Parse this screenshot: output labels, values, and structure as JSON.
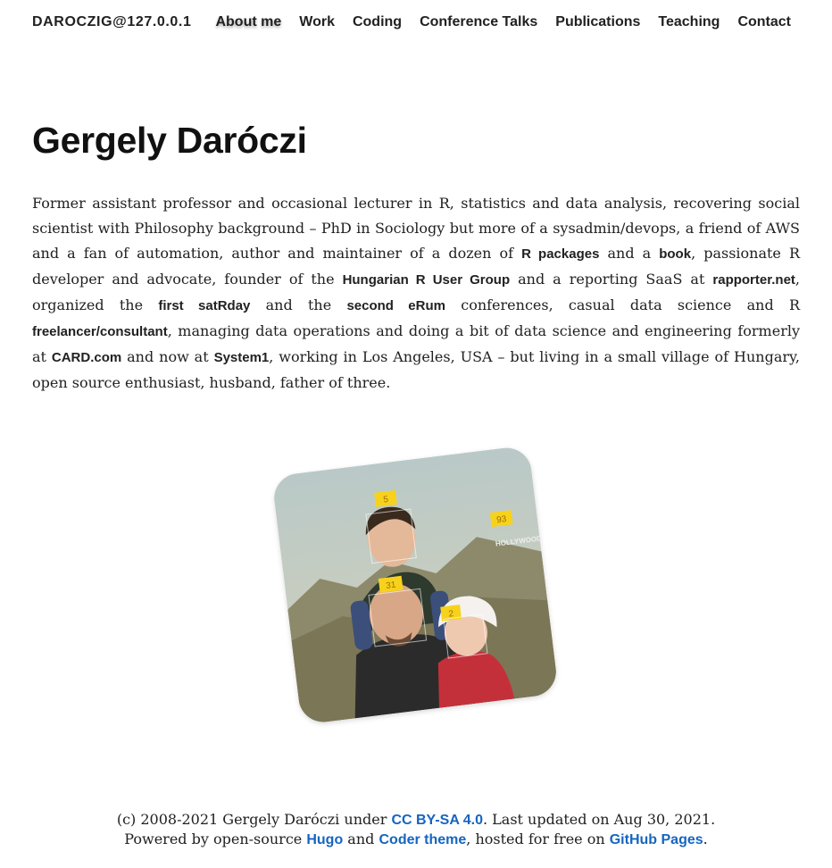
{
  "site": {
    "brand": "DAROCZIG@127.0.0.1"
  },
  "nav": [
    {
      "label": "About me",
      "active": true
    },
    {
      "label": "Work"
    },
    {
      "label": "Coding"
    },
    {
      "label": "Conference Talks"
    },
    {
      "label": "Publications"
    },
    {
      "label": "Teaching"
    },
    {
      "label": "Contact"
    }
  ],
  "page": {
    "title": "Gergely Daróczi"
  },
  "bio": {
    "t1": "Former assistant professor and occasional lecturer in R, statistics and data analysis, recovering social scientist with Philosophy background – PhD in Sociology but more of a sysadmin/devops, a friend of AWS and a fan of automation, author and maintainer of a dozen of ",
    "l_rpackages": "R packages",
    "t2": " and a ",
    "l_book": "book",
    "t3": ", passionate R developer and advocate, founder of the ",
    "l_hrug": "Hungarian R User Group",
    "t4": " and a reporting SaaS at ",
    "l_rapporter": "rapporter.net",
    "t5": ", organized the ",
    "l_satrday": "first satRday",
    "t6": " and the ",
    "l_erum": "second eRum",
    "t7": " conferences, casual data science and R ",
    "l_freelancer": "freelancer/consultant",
    "t8": ", managing data operations and doing a bit of data science and engineering formerly at ",
    "l_card": "CARD.com",
    "t9": " and now at ",
    "l_system1": "System1",
    "t10": ", working in Los Angeles, USA – but living in a small village of Hungary, open source enthusiast, husband, father of three."
  },
  "photo": {
    "age_tags": [
      "5",
      "93",
      "31",
      "2"
    ]
  },
  "footer": {
    "t1": "(c) 2008-2021 Gergely Daróczi under ",
    "l_license": "CC BY-SA 4.0",
    "t2": ". Last updated on Aug 30, 2021.",
    "t3": "Powered by open-source ",
    "l_hugo": "Hugo",
    "t4": " and ",
    "l_coder": "Coder theme",
    "t5": ", hosted for free on ",
    "l_ghpages": "GitHub Pages",
    "t6": "."
  },
  "colors": {
    "link": "#1565c0",
    "text": "#212121",
    "tag": "#f7d21c"
  }
}
